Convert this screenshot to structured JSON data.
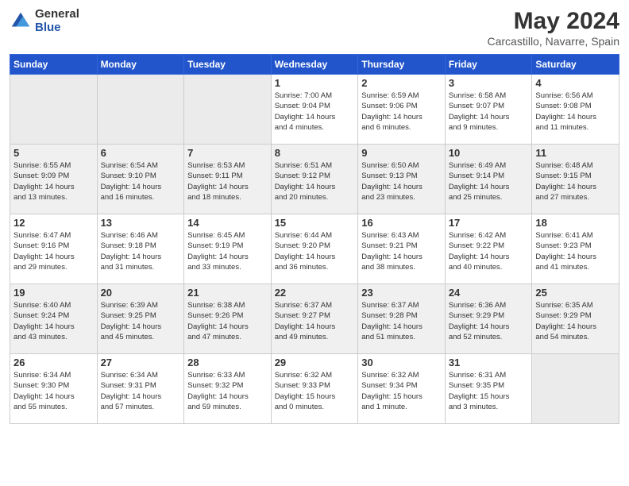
{
  "logo": {
    "general": "General",
    "blue": "Blue"
  },
  "title": "May 2024",
  "subtitle": "Carcastillo, Navarre, Spain",
  "headers": [
    "Sunday",
    "Monday",
    "Tuesday",
    "Wednesday",
    "Thursday",
    "Friday",
    "Saturday"
  ],
  "weeks": [
    [
      {
        "day": "",
        "info": ""
      },
      {
        "day": "",
        "info": ""
      },
      {
        "day": "",
        "info": ""
      },
      {
        "day": "1",
        "info": "Sunrise: 7:00 AM\nSunset: 9:04 PM\nDaylight: 14 hours\nand 4 minutes."
      },
      {
        "day": "2",
        "info": "Sunrise: 6:59 AM\nSunset: 9:06 PM\nDaylight: 14 hours\nand 6 minutes."
      },
      {
        "day": "3",
        "info": "Sunrise: 6:58 AM\nSunset: 9:07 PM\nDaylight: 14 hours\nand 9 minutes."
      },
      {
        "day": "4",
        "info": "Sunrise: 6:56 AM\nSunset: 9:08 PM\nDaylight: 14 hours\nand 11 minutes."
      }
    ],
    [
      {
        "day": "5",
        "info": "Sunrise: 6:55 AM\nSunset: 9:09 PM\nDaylight: 14 hours\nand 13 minutes."
      },
      {
        "day": "6",
        "info": "Sunrise: 6:54 AM\nSunset: 9:10 PM\nDaylight: 14 hours\nand 16 minutes."
      },
      {
        "day": "7",
        "info": "Sunrise: 6:53 AM\nSunset: 9:11 PM\nDaylight: 14 hours\nand 18 minutes."
      },
      {
        "day": "8",
        "info": "Sunrise: 6:51 AM\nSunset: 9:12 PM\nDaylight: 14 hours\nand 20 minutes."
      },
      {
        "day": "9",
        "info": "Sunrise: 6:50 AM\nSunset: 9:13 PM\nDaylight: 14 hours\nand 23 minutes."
      },
      {
        "day": "10",
        "info": "Sunrise: 6:49 AM\nSunset: 9:14 PM\nDaylight: 14 hours\nand 25 minutes."
      },
      {
        "day": "11",
        "info": "Sunrise: 6:48 AM\nSunset: 9:15 PM\nDaylight: 14 hours\nand 27 minutes."
      }
    ],
    [
      {
        "day": "12",
        "info": "Sunrise: 6:47 AM\nSunset: 9:16 PM\nDaylight: 14 hours\nand 29 minutes."
      },
      {
        "day": "13",
        "info": "Sunrise: 6:46 AM\nSunset: 9:18 PM\nDaylight: 14 hours\nand 31 minutes."
      },
      {
        "day": "14",
        "info": "Sunrise: 6:45 AM\nSunset: 9:19 PM\nDaylight: 14 hours\nand 33 minutes."
      },
      {
        "day": "15",
        "info": "Sunrise: 6:44 AM\nSunset: 9:20 PM\nDaylight: 14 hours\nand 36 minutes."
      },
      {
        "day": "16",
        "info": "Sunrise: 6:43 AM\nSunset: 9:21 PM\nDaylight: 14 hours\nand 38 minutes."
      },
      {
        "day": "17",
        "info": "Sunrise: 6:42 AM\nSunset: 9:22 PM\nDaylight: 14 hours\nand 40 minutes."
      },
      {
        "day": "18",
        "info": "Sunrise: 6:41 AM\nSunset: 9:23 PM\nDaylight: 14 hours\nand 41 minutes."
      }
    ],
    [
      {
        "day": "19",
        "info": "Sunrise: 6:40 AM\nSunset: 9:24 PM\nDaylight: 14 hours\nand 43 minutes."
      },
      {
        "day": "20",
        "info": "Sunrise: 6:39 AM\nSunset: 9:25 PM\nDaylight: 14 hours\nand 45 minutes."
      },
      {
        "day": "21",
        "info": "Sunrise: 6:38 AM\nSunset: 9:26 PM\nDaylight: 14 hours\nand 47 minutes."
      },
      {
        "day": "22",
        "info": "Sunrise: 6:37 AM\nSunset: 9:27 PM\nDaylight: 14 hours\nand 49 minutes."
      },
      {
        "day": "23",
        "info": "Sunrise: 6:37 AM\nSunset: 9:28 PM\nDaylight: 14 hours\nand 51 minutes."
      },
      {
        "day": "24",
        "info": "Sunrise: 6:36 AM\nSunset: 9:29 PM\nDaylight: 14 hours\nand 52 minutes."
      },
      {
        "day": "25",
        "info": "Sunrise: 6:35 AM\nSunset: 9:29 PM\nDaylight: 14 hours\nand 54 minutes."
      }
    ],
    [
      {
        "day": "26",
        "info": "Sunrise: 6:34 AM\nSunset: 9:30 PM\nDaylight: 14 hours\nand 55 minutes."
      },
      {
        "day": "27",
        "info": "Sunrise: 6:34 AM\nSunset: 9:31 PM\nDaylight: 14 hours\nand 57 minutes."
      },
      {
        "day": "28",
        "info": "Sunrise: 6:33 AM\nSunset: 9:32 PM\nDaylight: 14 hours\nand 59 minutes."
      },
      {
        "day": "29",
        "info": "Sunrise: 6:32 AM\nSunset: 9:33 PM\nDaylight: 15 hours\nand 0 minutes."
      },
      {
        "day": "30",
        "info": "Sunrise: 6:32 AM\nSunset: 9:34 PM\nDaylight: 15 hours\nand 1 minute."
      },
      {
        "day": "31",
        "info": "Sunrise: 6:31 AM\nSunset: 9:35 PM\nDaylight: 15 hours\nand 3 minutes."
      },
      {
        "day": "",
        "info": ""
      }
    ]
  ]
}
